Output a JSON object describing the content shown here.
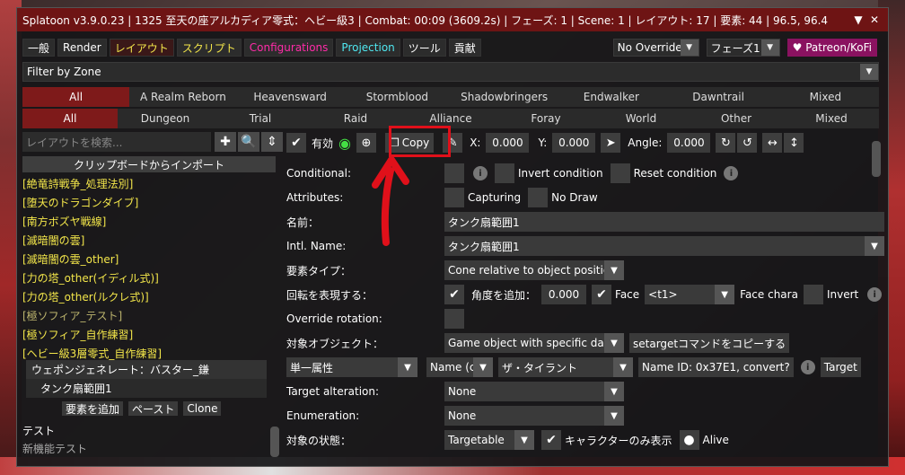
{
  "colors": {
    "accent": "#7e1a1a",
    "title_bg": "#6e1414",
    "highlight": "#e0101a"
  },
  "title": "Splatoon v3.9.0.23 | 1325 至天の座アルカディア零式：ヘビー級3 | Combat: 00:09 (3609.2s) | フェーズ: 1 | Scene: 1 | レイアウト: 17 | 要素: 44 | 96.5, 96.4",
  "titlebar_icons": [
    "triangle-down-icon",
    "close-icon"
  ],
  "tabs": [
    "一般",
    "Render",
    "レイアウト",
    "スクリプト",
    "Configurations",
    "Projection",
    "ツール",
    "貢献"
  ],
  "override_combo": "No Override",
  "phase_combo": "フェーズ1",
  "patreon": "♥ Patreon/KoFi",
  "filter": "Filter by Zone",
  "expansions": [
    "All",
    "A Realm Reborn",
    "Heavensward",
    "Stormblood",
    "Shadowbringers",
    "Endwalker",
    "Dawntrail",
    "Mixed"
  ],
  "categories": [
    "All",
    "Dungeon",
    "Trial",
    "Raid",
    "Alliance",
    "Foray",
    "World",
    "Other",
    "Mixed"
  ],
  "search_placeholder": "レイアウトを検索...",
  "import_label": "クリップボードからインポート",
  "layouts": [
    "[絶竜詩戦争_処理法別]",
    "[堕天のドラゴンダイブ]",
    "[南方ボズヤ戦線]",
    "[滅暗闇の雲]",
    "[滅暗闇の雲_other]",
    "[力の塔_other(イディル式)]",
    "[力の塔_other(ルクレ式)]",
    "[極ソフィア_テスト]",
    "[極ソフィア_自作練習]",
    "[ヘビー級3層零式_自作練習]"
  ],
  "elements": [
    "ウェポンジェネレート：バスター_鎌",
    "タンク扇範囲1"
  ],
  "left_actions": [
    "要素を追加",
    "ペースト",
    "Clone"
  ],
  "left_sub": [
    "テスト",
    "新機能テスト"
  ],
  "editor": {
    "enabled_label": "有効",
    "copy_label": "Copy",
    "x_label": "X:",
    "x_value": "0.000",
    "y_label": "Y:",
    "y_value": "0.000",
    "angle_label": "Angle:",
    "angle_value": "0.000",
    "conditional": "Conditional:",
    "invert_condition": "Invert condition",
    "reset_condition": "Reset condition",
    "attributes": "Attributes:",
    "capturing": "Capturing",
    "no_draw": "No Draw",
    "name_label": "名前：",
    "name_value": "タンク扇範囲1",
    "intl_name_label": "Intl. Name:",
    "intl_name_value": "タンク扇範囲1",
    "element_type_label": "要素タイプ：",
    "element_type_value": "Cone relative to object position",
    "rotation_label": "回転を表現する：",
    "add_angle_label": "角度を追加：",
    "add_angle_value": "0.000",
    "face_label": "Face",
    "face_value": "<t1>",
    "face_chara": "Face chara",
    "invert": "Invert",
    "override_rotation": "Override rotation:",
    "target_object_label": "対象オブジェクト：",
    "target_object_value": "Game object with specific data",
    "settarget_btn": "setargetコマンドをコピーする",
    "single_attr": "単一属性",
    "name_c": "Name (c",
    "boss_name": "ザ・タイラント",
    "name_id": "Name ID: 0x37E1, convert?",
    "target_btn": "Target",
    "target_alt_label": "Target alteration:",
    "target_alt_value": "None",
    "enumeration_label": "Enumeration:",
    "enumeration_value": "None",
    "target_state_label": "対象の状態：",
    "target_state_value": "Targetable",
    "chara_only": "キャラクターのみ表示",
    "alive": "Alive"
  }
}
